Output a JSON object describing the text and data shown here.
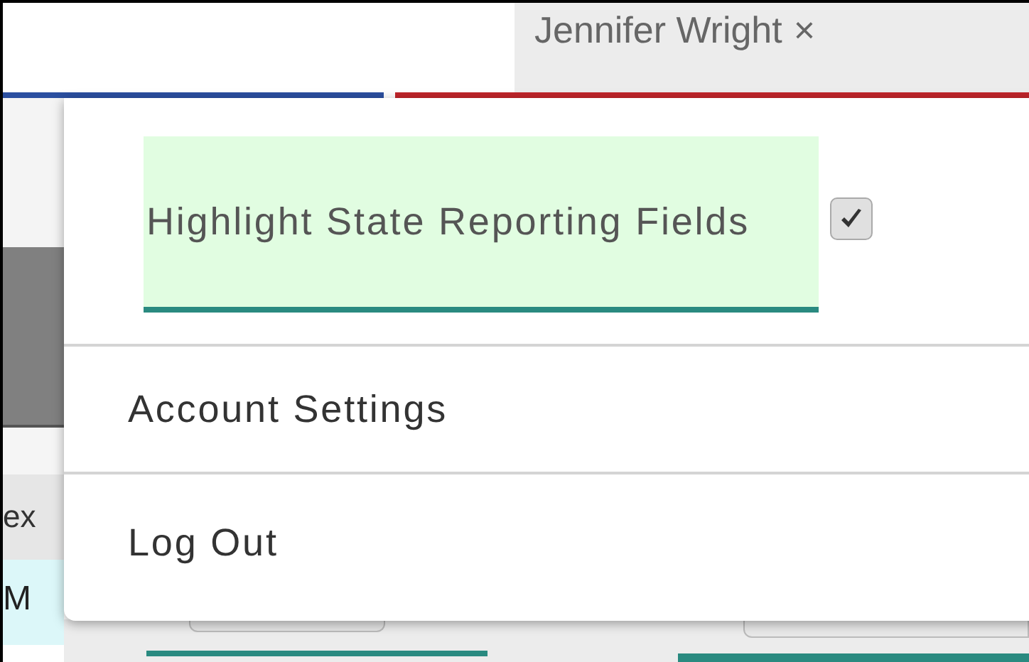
{
  "header": {
    "user_name": "Jennifer Wright",
    "close_glyph": "×"
  },
  "menu": {
    "highlight_option": {
      "label": "Highlight State Reporting Fields",
      "checked": true
    },
    "items": [
      {
        "label": "Account Settings"
      },
      {
        "label": "Log Out"
      }
    ]
  },
  "background": {
    "column_label": "ex",
    "cell_text": "M"
  }
}
